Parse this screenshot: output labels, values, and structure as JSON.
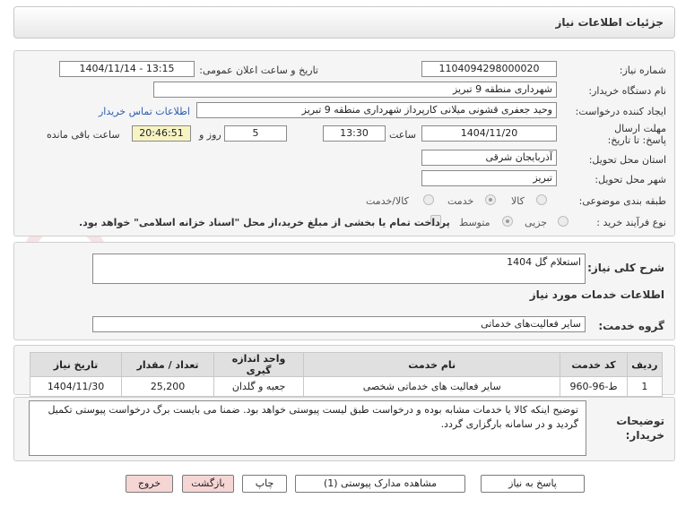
{
  "title": "جزئیات اطلاعات نیاز",
  "watermark": "AriaTender.net",
  "labels": {
    "need_number": "شماره نیاز:",
    "announce_datetime": "تاریخ و ساعت اعلان عمومی:",
    "buyer_org": "نام دستگاه خریدار:",
    "requester": "ایجاد کننده درخواست:",
    "deadline": "مهلت ارسال پاسخ: تا تاریخ:",
    "time_word": "ساعت",
    "days_and": "روز و",
    "remaining": "ساعت باقی مانده",
    "province": "استان محل تحویل:",
    "city": "شهر محل تحویل:",
    "category": "طبقه بندی موضوعی:",
    "purchase_type": "نوع فرآیند خرید :",
    "general_desc": "شرح کلی نیاز:",
    "services_info": "اطلاعات خدمات مورد نیاز",
    "service_group": "گروه خدمت:",
    "buyer_notes": "توضیحات خریدار:"
  },
  "values": {
    "need_number": "1104094298000020",
    "announce_datetime": "1404/11/14 - 13:15",
    "buyer_org": "شهرداری منطقه 9 تبریز",
    "requester": "وحید جعفری قشونی میلانی کارپرداز شهرداری منطقه 9 تبریز",
    "contact_link": "اطلاعات تماس خریدار",
    "deadline_date": "1404/11/20",
    "deadline_time": "13:30",
    "days": "5",
    "remaining_time": "20:46:51",
    "province": "آذربایجان شرقی",
    "city": "تبریز",
    "general_desc": "استعلام گل 1404",
    "service_group": "سایر فعالیت‌های خدماتی",
    "buyer_notes": "توضیح اینکه کالا یا خدمات مشابه بوده و درخواست طبق لیست پیوستی خواهد بود. ضمنا می بایست برگ درخواست پیوستی تکمیل گردید و در سامانه بارگزاری گردد."
  },
  "category_options": {
    "goods": "کالا",
    "service": "خدمت",
    "goods_service": "کالا/خدمت",
    "selected": "خدمت"
  },
  "purchase_options": {
    "partial": "جزیی",
    "medium": "متوسط",
    "selected": "متوسط",
    "treasury_note": "پرداخت تمام یا بخشی از مبلغ خرید،از محل \"اسناد خزانه اسلامی\" خواهد بود."
  },
  "table": {
    "headers": [
      "ردیف",
      "کد خدمت",
      "نام خدمت",
      "واحد اندازه گیری",
      "تعداد / مقدار",
      "تاریخ نیاز"
    ],
    "rows": [
      [
        "1",
        "ط-96-960",
        "سایر فعالیت های خدماتی شخصی",
        "جعبه و گلدان",
        "25,200",
        "1404/11/30"
      ]
    ]
  },
  "buttons": {
    "reply": "پاسخ به نیاز",
    "view_docs": "مشاهده مدارک پیوستی (1)",
    "print": "چاپ",
    "back": "بازگشت",
    "exit": "خروج"
  }
}
